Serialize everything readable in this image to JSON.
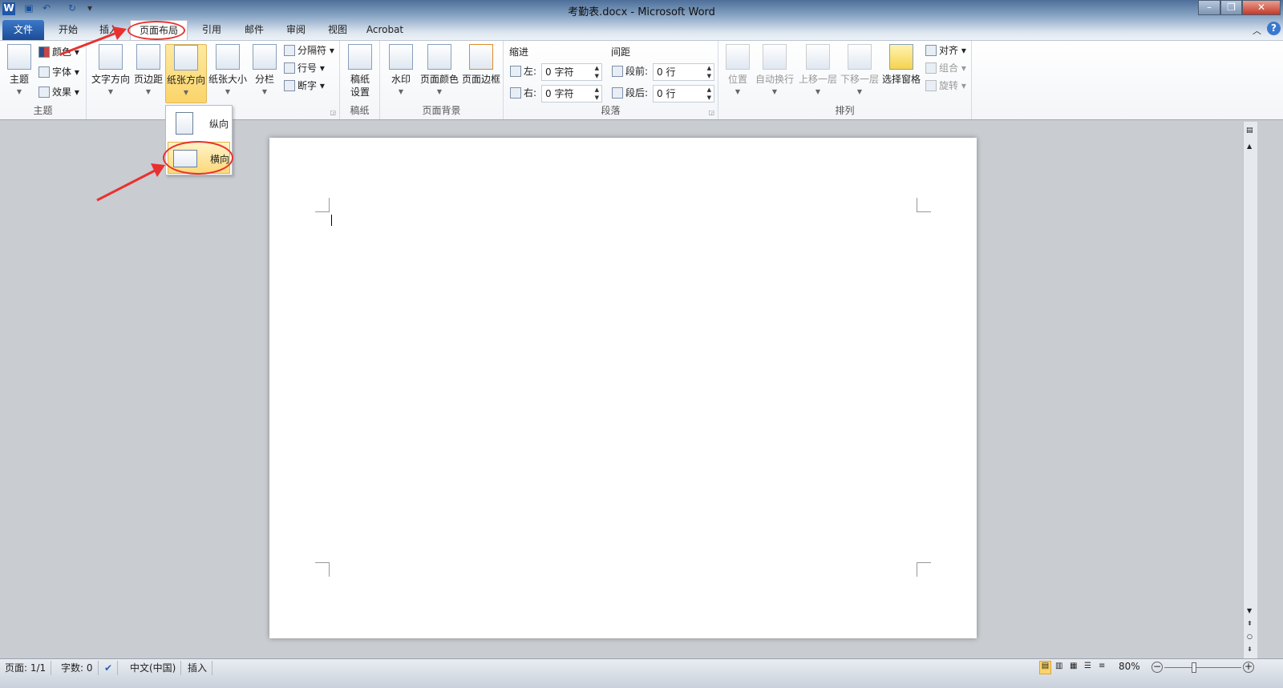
{
  "window": {
    "title": "考勤表.docx - Microsoft Word",
    "app_icon": "word-icon"
  },
  "quick_access": {
    "save": "save-icon",
    "undo": "undo-icon",
    "redo": "redo-icon",
    "customize": "▾"
  },
  "tabs": [
    {
      "label": "文件"
    },
    {
      "label": "开始"
    },
    {
      "label": "插入"
    },
    {
      "label": "页面布局",
      "active": true
    },
    {
      "label": "引用"
    },
    {
      "label": "邮件"
    },
    {
      "label": "审阅"
    },
    {
      "label": "视图"
    },
    {
      "label": "Acrobat"
    }
  ],
  "ribbon": {
    "theme": {
      "label": "主题",
      "big": "主题",
      "colors": "颜色",
      "fonts": "字体",
      "effects": "效果"
    },
    "page_setup": {
      "text_direction": "文字方向",
      "margins": "页边距",
      "orientation": "纸张方向",
      "size": "纸张大小",
      "columns": "分栏",
      "breaks": "分隔符",
      "line_numbers": "行号",
      "hyphenation": "断字"
    },
    "manuscript": {
      "label": "稿纸",
      "button": "稿纸\n设置",
      "line1": "稿纸",
      "line2": "设置"
    },
    "page_background": {
      "label": "页面背景",
      "watermark": "水印",
      "page_color": "页面颜色",
      "page_borders": "页面边框"
    },
    "paragraph": {
      "label": "段落",
      "indent": "缩进",
      "left_label": "左:",
      "left_value": "0 字符",
      "right_label": "右:",
      "right_value": "0 字符",
      "spacing": "间距",
      "before_label": "段前:",
      "before_value": "0 行",
      "after_label": "段后:",
      "after_value": "0 行"
    },
    "arrange": {
      "label": "排列",
      "position": "位置",
      "wrap": "自动换行",
      "forward": "上移一层",
      "backward": "下移一层",
      "selection_pane": "选择窗格",
      "align": "对齐",
      "group": "组合",
      "rotate": "旋转"
    }
  },
  "orientation_menu": {
    "portrait": "纵向",
    "landscape": "横向",
    "selected": "横向"
  },
  "status": {
    "page": "页面: 1/1",
    "words": "字数: 0",
    "language": "中文(中国)",
    "mode": "插入",
    "zoom": "80%"
  },
  "zoom_level_percent": 80,
  "colors": {
    "file_tab": "#2a62b5",
    "highlight": "#fbd46a",
    "annotation": "#e8312f"
  }
}
